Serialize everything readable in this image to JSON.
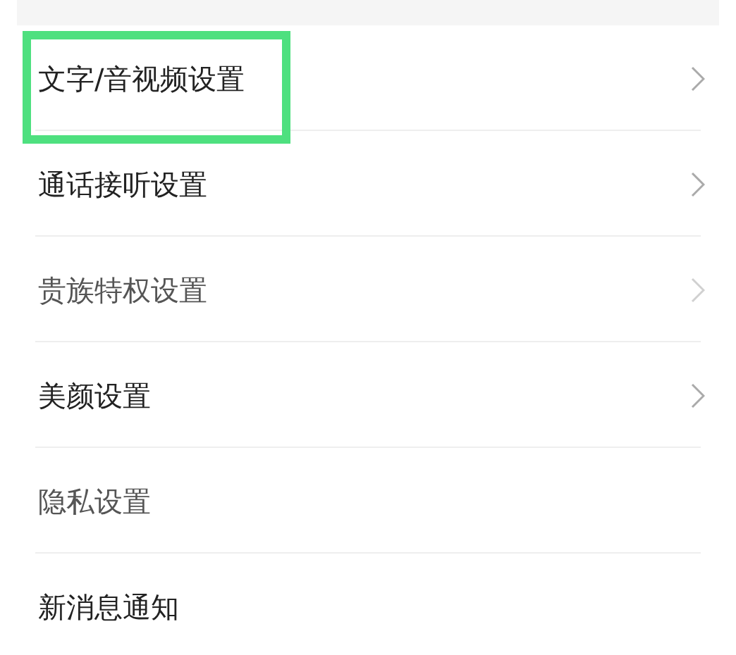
{
  "settings": [
    {
      "label": "文字/音视频设置",
      "chevron": true,
      "dimmed": false,
      "highlighted": true
    },
    {
      "label": "通话接听设置",
      "chevron": true,
      "dimmed": false,
      "highlighted": false
    },
    {
      "label": "贵族特权设置",
      "chevron": true,
      "dimmed": true,
      "highlighted": false
    },
    {
      "label": "美颜设置",
      "chevron": true,
      "dimmed": false,
      "highlighted": false
    },
    {
      "label": "隐私设置",
      "chevron": false,
      "dimmed": true,
      "highlighted": false
    },
    {
      "label": "新消息通知",
      "chevron": false,
      "dimmed": false,
      "highlighted": false
    }
  ]
}
